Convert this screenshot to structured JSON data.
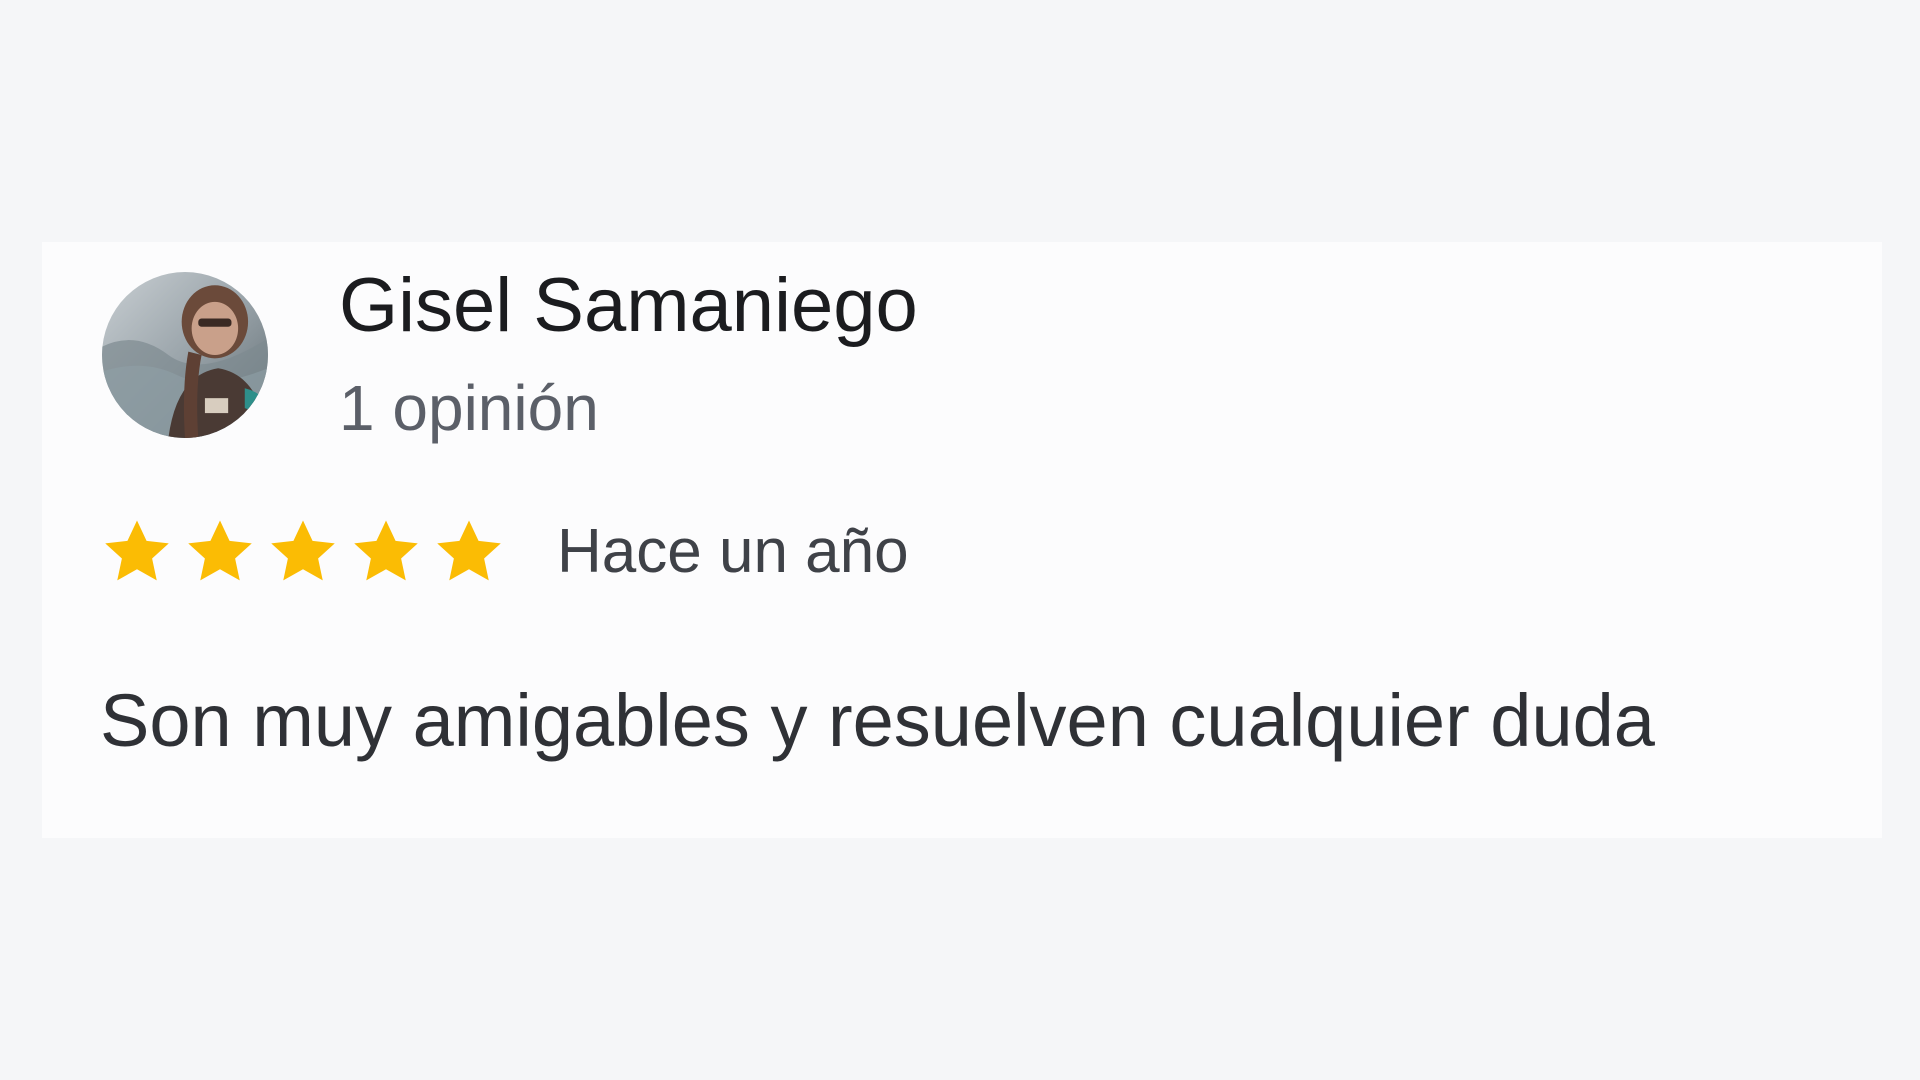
{
  "review": {
    "reviewer": {
      "name": "Gisel Samaniego",
      "avatar_icon": "reviewer-photo",
      "review_count_label": "1 opinión"
    },
    "rating": {
      "stars": 5,
      "max_stars": 5,
      "star_icon": "star-icon",
      "star_color": "#fbbc04"
    },
    "date_label": "Hace un año",
    "text": "Son muy amigables y resuelven cualquier duda"
  }
}
